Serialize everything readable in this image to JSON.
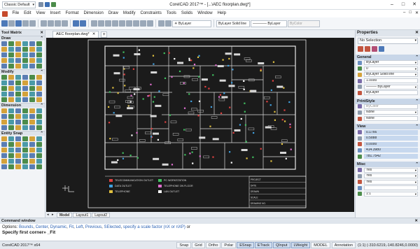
{
  "titlebar": {
    "workspace": "Classic Default",
    "title": "CorelCAD 2017™ - [...\\AEC floorplan.dwg*]",
    "minimize": "–",
    "maximize": "□",
    "close": "✕"
  },
  "menubar": {
    "items": [
      "File",
      "Edit",
      "View",
      "Insert",
      "Format",
      "Dimension",
      "Draw",
      "Modify",
      "Constraints",
      "Tools",
      "Solids",
      "Window",
      "Help"
    ]
  },
  "toolbar": {
    "layer": "ByLayer",
    "linetype": "Solid line",
    "lineweight": "———— ByLayer",
    "color": "ByColor"
  },
  "left_panel": {
    "title": "Tool Matrix",
    "sections": [
      {
        "label": "Draw",
        "rows": 5
      },
      {
        "label": "Modify",
        "rows": 5
      },
      {
        "label": "Dimension",
        "rows": 4
      },
      {
        "label": "Entity Snap",
        "rows": 6
      }
    ]
  },
  "document": {
    "tabs": [
      {
        "label": "AEC floorplan.dwg*",
        "close": "✕"
      }
    ],
    "new_tab": "+",
    "layout_tabs": [
      "Model",
      "Layout1",
      "Layout2"
    ]
  },
  "drawing": {
    "legend": [
      {
        "label": "TELECOMMUNICATION OUTLET"
      },
      {
        "label": "DATA OUTLET"
      },
      {
        "label": "TELEPHONE"
      },
      {
        "label": "PC WORKSTATION"
      },
      {
        "label": "TELEPHONE ON FLOOR"
      },
      {
        "label": "LAN OUTLET"
      }
    ],
    "title_block": [
      "PROJECT",
      "DATE",
      "DRAWN",
      "SCALE",
      "DRAWING NO."
    ]
  },
  "properties": {
    "title": "Properties",
    "selection": "No Selection",
    "sections": {
      "general": {
        "label": "General",
        "rows": [
          {
            "value": "ByLayer",
            "kind": "dd"
          },
          {
            "value": "0",
            "kind": "dd"
          },
          {
            "value": "ByLayer    Solid line",
            "kind": "dd"
          },
          {
            "value": "1.0000",
            "kind": "txt"
          },
          {
            "value": "——— ByLayer",
            "kind": "dd"
          },
          {
            "value": "ByLayer",
            "kind": "txt"
          }
        ]
      },
      "printstyle": {
        "label": "PrintStyle",
        "rows": [
          {
            "value": "ByColor",
            "kind": "gr"
          },
          {
            "value": "None",
            "kind": "dd"
          },
          {
            "value": "None",
            "kind": "txt"
          }
        ]
      },
      "view": {
        "label": "View",
        "rows": [
          {
            "value": "0.1766",
            "kind": "hl"
          },
          {
            "value": "0.5888",
            "kind": "hl"
          },
          {
            "value": "0.0000",
            "kind": "hl"
          },
          {
            "value": "414.3980",
            "kind": "hl"
          },
          {
            "value": "781.7542",
            "kind": "hl"
          }
        ]
      },
      "misc": {
        "label": "Misc",
        "rows": [
          {
            "value": "Yes",
            "kind": "dd"
          },
          {
            "value": "Yes",
            "kind": "dd"
          },
          {
            "value": "Yes",
            "kind": "dd"
          },
          {
            "value": "",
            "kind": "txt"
          },
          {
            "value": "1:1",
            "kind": "dd"
          }
        ]
      }
    }
  },
  "command_window": {
    "title": "Command window",
    "options_prefix": "Options: ",
    "options": [
      "Bounds",
      "Center",
      "Dynamic",
      "Fit",
      "Left",
      "Previous",
      "SElected",
      "specify a scale factor (nX or nXP)"
    ],
    "options_suffix": " or",
    "prompt": "Specify first corner» _Fit"
  },
  "status": {
    "app": "CorelCAD 2017™ x64",
    "buttons": [
      {
        "label": "Snap",
        "on": false
      },
      {
        "label": "Grid",
        "on": false
      },
      {
        "label": "Ortho",
        "on": false
      },
      {
        "label": "Polar",
        "on": false
      },
      {
        "label": "ESnap",
        "on": true
      },
      {
        "label": "ETrack",
        "on": true
      },
      {
        "label": "QInput",
        "on": true
      },
      {
        "label": "LWeight",
        "on": true
      },
      {
        "label": "MODEL",
        "on": false
      }
    ],
    "annotation": "Annotation",
    "scale": "(1:1)",
    "coords": "(-310.6219,-140.8246,0.0000)"
  }
}
